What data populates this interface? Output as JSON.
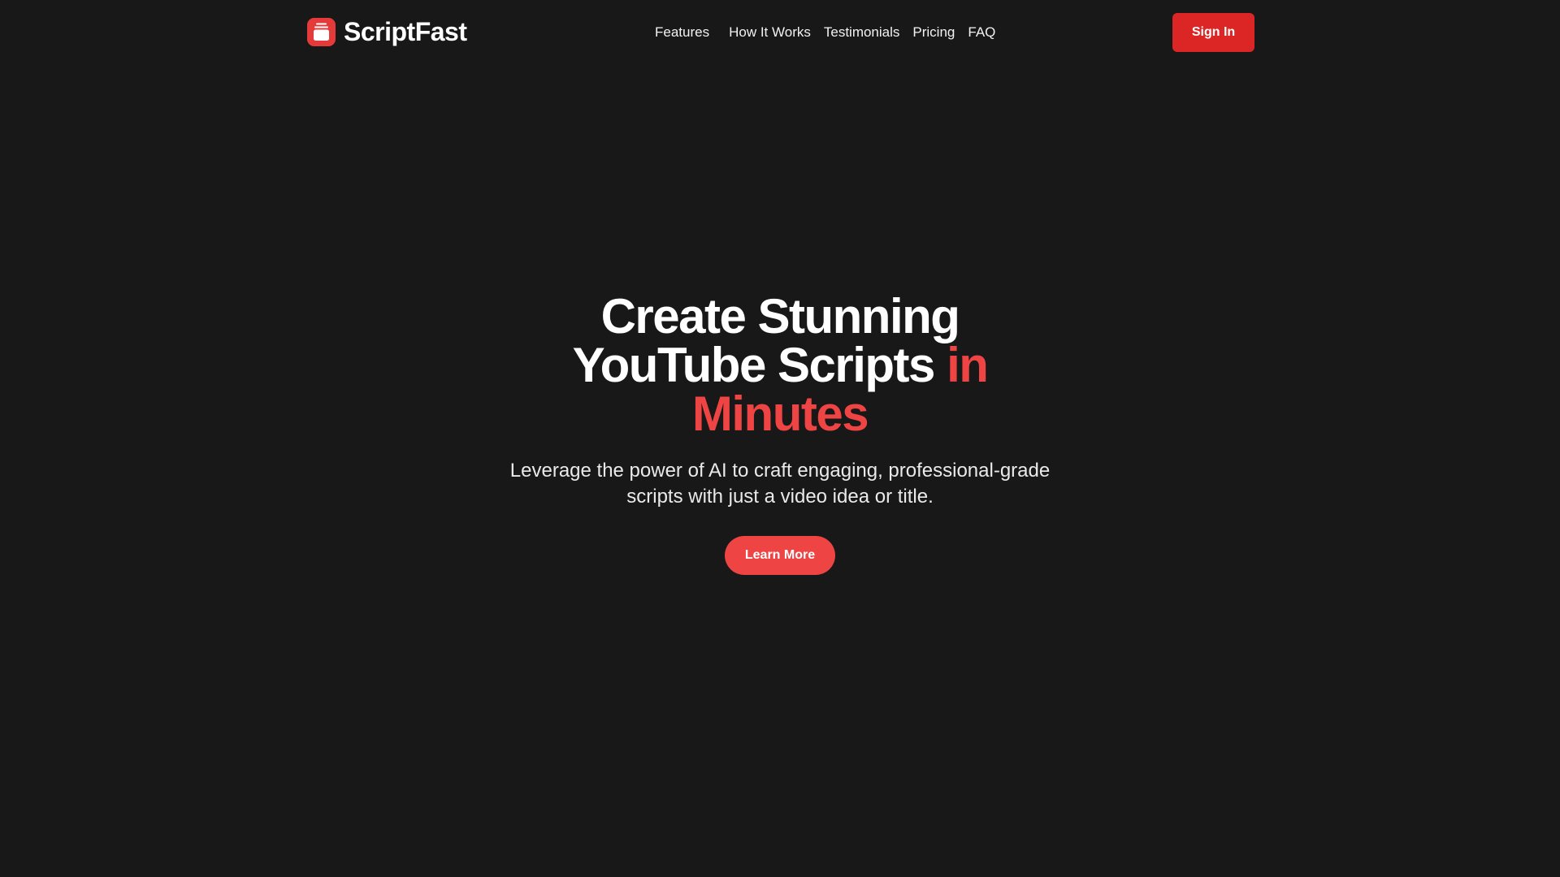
{
  "brand": {
    "name": "ScriptFast",
    "logo_icon": "script-logo-icon",
    "logo_color": "#e53a3a"
  },
  "nav": {
    "items": [
      {
        "label": "Features"
      },
      {
        "label": "How It Works"
      },
      {
        "label": "Testimonials"
      },
      {
        "label": "Pricing"
      },
      {
        "label": "FAQ"
      }
    ]
  },
  "header": {
    "sign_in_label": "Sign In",
    "sign_in_color": "#dc2626"
  },
  "hero": {
    "title_main": "Create Stunning YouTube Scripts",
    "title_accent": "in Minutes",
    "subtitle": "Leverage the power of AI to craft engaging, professional-grade scripts with just a video idea or title.",
    "cta_label": "Learn More",
    "accent_color": "#ef4444"
  },
  "theme": {
    "background": "#181818",
    "text": "#ffffff"
  }
}
